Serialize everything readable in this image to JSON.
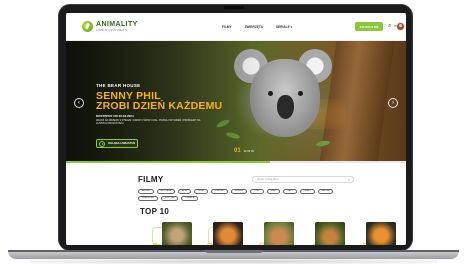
{
  "header": {
    "logo_name": "ANIMALITY",
    "logo_tagline": "WORLD OF ANIMALS",
    "nav": [
      "FILMY",
      "ZWIERZĘTA",
      "SERIALE"
    ],
    "cta_label": "ZALOGUJ SIĘ",
    "lang": "PL",
    "search_icon": "search-icon"
  },
  "hero": {
    "eyebrow": "THE BEAR HOUSE",
    "headline_line1": "SENNY PHIL",
    "headline_line2": "ZROBI DZIEŃ KAŻDEMU",
    "date": "DOSTĘPNY OD 23.03.2024",
    "description": "WEJDŹ NA DRZEWO Z PHILEM I ODKRYJ ŚWIAT KOAL. POZNAJ ICH DZIEŃ I PROBLEMY NA AUSTRALIJSKIM BUSZU.",
    "play_label": "OGLĄDAJ ZWIASTUN",
    "counter_current": "01",
    "counter_rest": "02   03   04",
    "accent": "#f6b11a",
    "green": "#8cc63f"
  },
  "films": {
    "title": "FILMY",
    "search_placeholder": "Wpisz nazwę filmu",
    "chips": [
      "AFRYKA",
      "AUSTRALIA",
      "AZJA",
      "DZIKIE",
      "DOMOWE",
      "MORSKIE",
      "PTAKI",
      "SSAKI",
      "GADY",
      "OWADY",
      "NATURA",
      "DRAPIEŻNIKI",
      "PUSTYNIA",
      "DŻUNGLA"
    ]
  },
  "top10": {
    "title": "TOP 10",
    "ranks": [
      "1",
      "2",
      "3",
      "4",
      "5"
    ]
  }
}
